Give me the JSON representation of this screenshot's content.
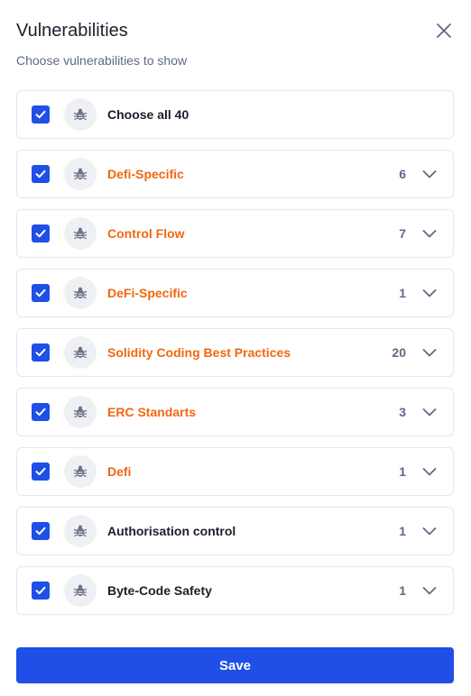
{
  "dialog": {
    "title": "Vulnerabilities",
    "subtitle": "Choose vulnerabilities to show",
    "close_icon": "close-icon"
  },
  "colors": {
    "accent": "#1f4fe6",
    "category_orange": "#f2670f",
    "muted": "#5d6a85"
  },
  "choose_all": {
    "label": "Choose all 40",
    "checked": true
  },
  "categories": [
    {
      "label": "Defi-Specific",
      "count": "6",
      "style": "orange",
      "checked": true
    },
    {
      "label": "Control Flow",
      "count": "7",
      "style": "orange",
      "checked": true
    },
    {
      "label": "DeFi-Specific",
      "count": "1",
      "style": "orange",
      "checked": true
    },
    {
      "label": "Solidity Coding Best Practices",
      "count": "20",
      "style": "orange",
      "checked": true
    },
    {
      "label": "ERC Standarts",
      "count": "3",
      "style": "orange",
      "checked": true
    },
    {
      "label": "Defi",
      "count": "1",
      "style": "orange",
      "checked": true
    },
    {
      "label": "Authorisation control",
      "count": "1",
      "style": "dark",
      "checked": true
    },
    {
      "label": "Byte-Code Safety",
      "count": "1",
      "style": "dark",
      "checked": true
    }
  ],
  "save_label": "Save"
}
